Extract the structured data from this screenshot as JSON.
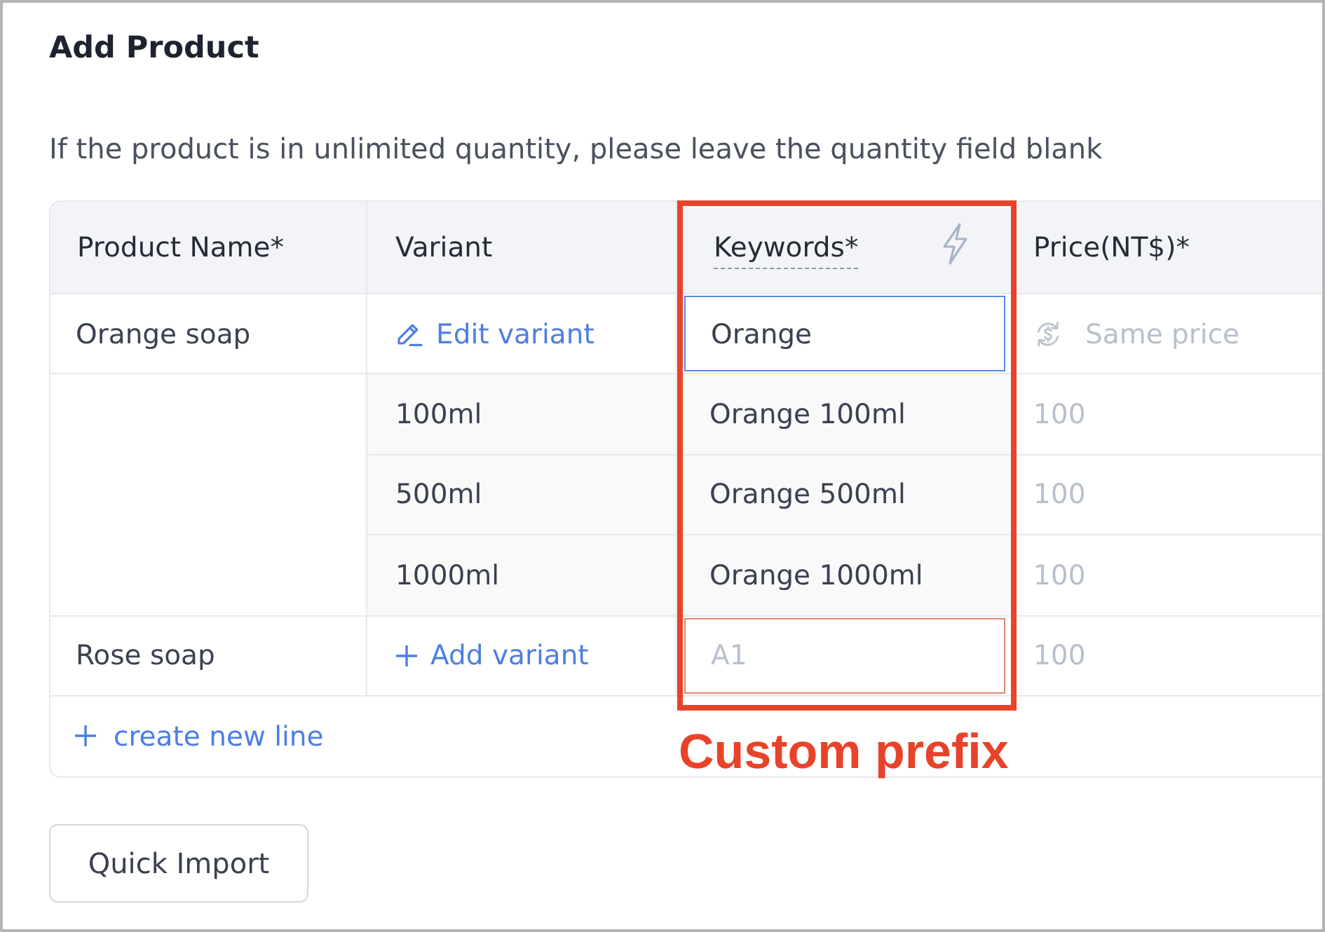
{
  "title": "Add Product",
  "notice": "If the product is in unlimited quantity, please leave the quantity field blank",
  "table": {
    "columns": [
      {
        "label": "Product Name*",
        "kind": "plain"
      },
      {
        "label": "Variant",
        "kind": "plain"
      },
      {
        "label": "Keywords*",
        "kind": "auto-fill"
      },
      {
        "label": "Price(NT$)*",
        "kind": "plain"
      }
    ],
    "products": [
      {
        "name": "Orange soap",
        "variant_action": {
          "kind": "edit",
          "label": "Edit variant"
        },
        "keyword": {
          "value": "Orange",
          "focused": true,
          "invalid": false
        },
        "price": {
          "kind": "same-price",
          "placeholder": "Same price"
        },
        "variants": [
          {
            "name": "100ml",
            "keyword": "Orange 100ml",
            "price_placeholder": "100"
          },
          {
            "name": "500ml",
            "keyword": "Orange 500ml",
            "price_placeholder": "100"
          },
          {
            "name": "1000ml",
            "keyword": "Orange 1000ml",
            "price_placeholder": "100"
          }
        ]
      },
      {
        "name": "Rose soap",
        "variant_action": {
          "kind": "add",
          "label": "Add variant"
        },
        "keyword": {
          "placeholder": "A1",
          "focused": false,
          "invalid": true
        },
        "price": {
          "kind": "plain",
          "placeholder": "100"
        }
      }
    ],
    "create_line": "create new line"
  },
  "annotation": {
    "label": "Custom prefix"
  },
  "buttons": [
    {
      "label": "Quick Import"
    }
  ]
}
